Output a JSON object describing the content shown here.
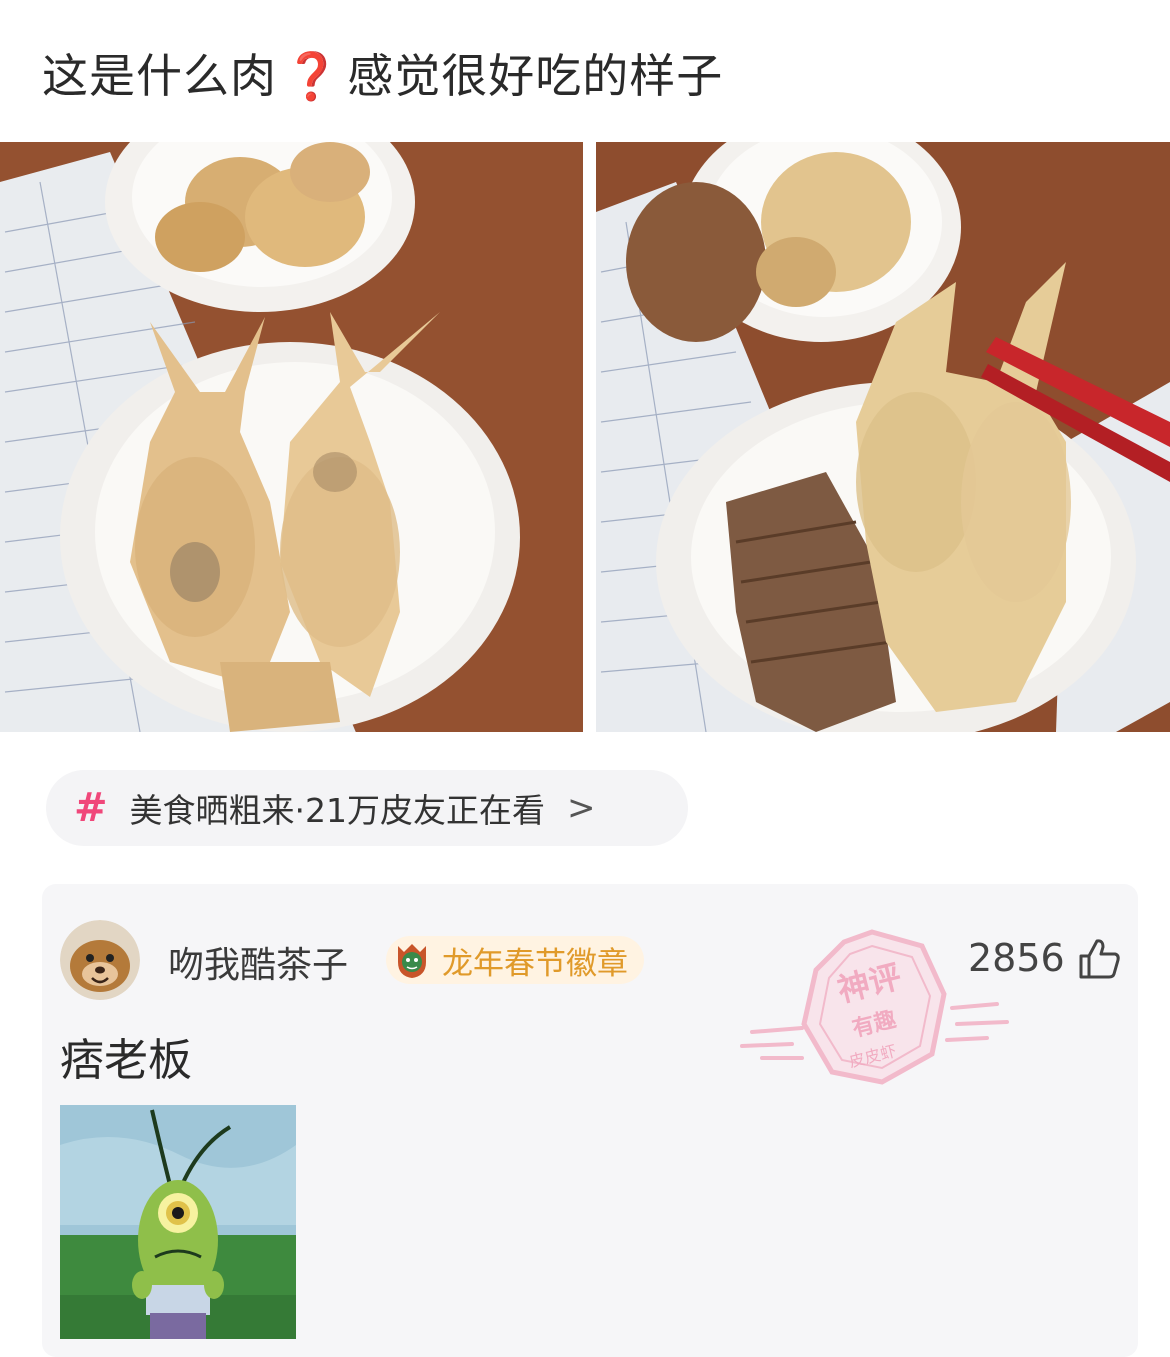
{
  "post": {
    "title_before": "这是什么肉",
    "title_mark": "❓",
    "title_after": "感觉很好吃的样子"
  },
  "topic": {
    "hash": "#",
    "text": "美食晒粗来·21万皮友正在看",
    "chevron": ">"
  },
  "comment": {
    "username": "吻我酷茶子",
    "badge": "龙年春节徽章",
    "stamp_lines": [
      "神评",
      "有趣",
      "皮皮虾"
    ],
    "likes": "2856",
    "text": "痞老板"
  },
  "icons": {
    "topic": "hashtag-icon",
    "like": "thumbs-up-icon",
    "badge": "dragon-badge-icon"
  },
  "colors": {
    "accent_pink": "#f0477a",
    "badge_orange": "#e09a2a",
    "question_red": "#e0302f"
  }
}
